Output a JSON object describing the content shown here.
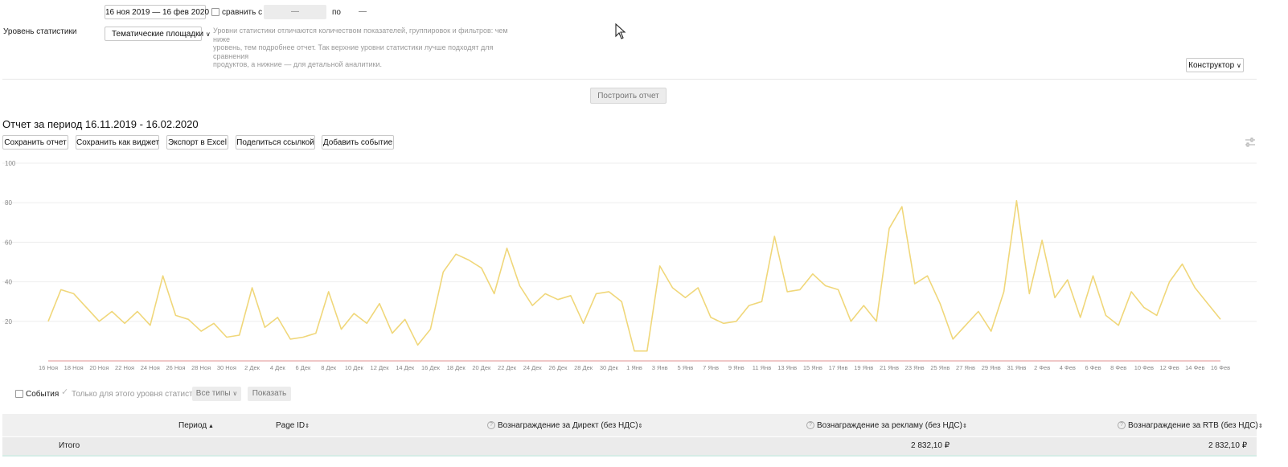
{
  "filters": {
    "date_range": "16 ноя 2019 — 16 фев 2020",
    "compare_label": "сравнить с",
    "compare_from": "—",
    "compare_to_label": "по",
    "compare_to": "—",
    "stat_level_label": "Уровень статистики",
    "stat_level_value": "Тематические площадки",
    "stat_level_hint_1": "Уровни статистики отличаются количеством показателей, группировок и фильтров: чем ниже",
    "stat_level_hint_2": "уровень, тем подробнее отчет. Так верхние уровни статистики лучше подходят для сравнения",
    "stat_level_hint_3": "продуктов, а нижние — для детальной аналитики.",
    "constructor_label": "Конструктор"
  },
  "build_button": "Построить отчет",
  "report": {
    "title": "Отчет за период 16.11.2019 - 16.02.2020",
    "actions": [
      "Сохранить отчет",
      "Сохранить как виджет",
      "Экспорт в Excel",
      "Поделиться ссылкой",
      "Добавить событие"
    ]
  },
  "chart_data": {
    "type": "line",
    "ylim": [
      0,
      100
    ],
    "yticks": [
      100,
      80,
      60,
      40,
      20
    ],
    "x_tick_labels": [
      "16 Ноя",
      "18 Ноя",
      "20 Ноя",
      "22 Ноя",
      "24 Ноя",
      "26 Ноя",
      "28 Ноя",
      "30 Ноя",
      "2 Дек",
      "4 Дек",
      "6 Дек",
      "8 Дек",
      "10 Дек",
      "12 Дек",
      "14 Дек",
      "16 Дек",
      "18 Дек",
      "20 Дек",
      "22 Дек",
      "24 Дек",
      "26 Дек",
      "28 Дек",
      "30 Дек",
      "1 Янв",
      "3 Янв",
      "5 Янв",
      "7 Янв",
      "9 Янв",
      "11 Янв",
      "13 Янв",
      "15 Янв",
      "17 Янв",
      "19 Янв",
      "21 Янв",
      "23 Янв",
      "25 Янв",
      "27 Янв",
      "29 Янв",
      "31 Янв",
      "2 Фев",
      "4 Фев",
      "6 Фев",
      "8 Фев",
      "10 Фев",
      "12 Фев",
      "14 Фев",
      "16 Фев"
    ],
    "series": [
      {
        "color": "#f0d77a",
        "values": [
          20,
          36,
          34,
          27,
          20,
          25,
          19,
          25,
          18,
          43,
          23,
          21,
          15,
          19,
          12,
          13,
          37,
          17,
          22,
          11,
          12,
          14,
          35,
          16,
          24,
          19,
          29,
          14,
          21,
          8,
          16,
          45,
          54,
          51,
          47,
          34,
          57,
          38,
          28,
          34,
          31,
          33,
          19,
          34,
          35,
          30,
          5,
          5,
          48,
          37,
          32,
          37,
          22,
          19,
          20,
          28,
          30,
          63,
          35,
          36,
          44,
          38,
          36,
          20,
          28,
          20,
          67,
          78,
          39,
          43,
          29,
          11,
          18,
          25,
          15,
          35,
          81,
          34,
          61,
          32,
          41,
          22,
          43,
          23,
          18,
          35,
          27,
          23,
          40,
          49,
          37,
          29,
          21
        ]
      }
    ]
  },
  "events": {
    "events_label": "События",
    "only_level_label": "Только для этого уровня статистики",
    "types_label": "Все типы",
    "show_label": "Показать"
  },
  "table": {
    "columns": [
      "Период",
      "Page ID",
      "Вознаграждение за Директ (без НДС)",
      "Вознаграждение за рекламу (без НДС)",
      "Вознаграждение за RTB (без НДС)"
    ],
    "total_label": "Итого",
    "total_ad": "2 832,10 ₽",
    "total_rtb": "2 832,10 ₽"
  }
}
